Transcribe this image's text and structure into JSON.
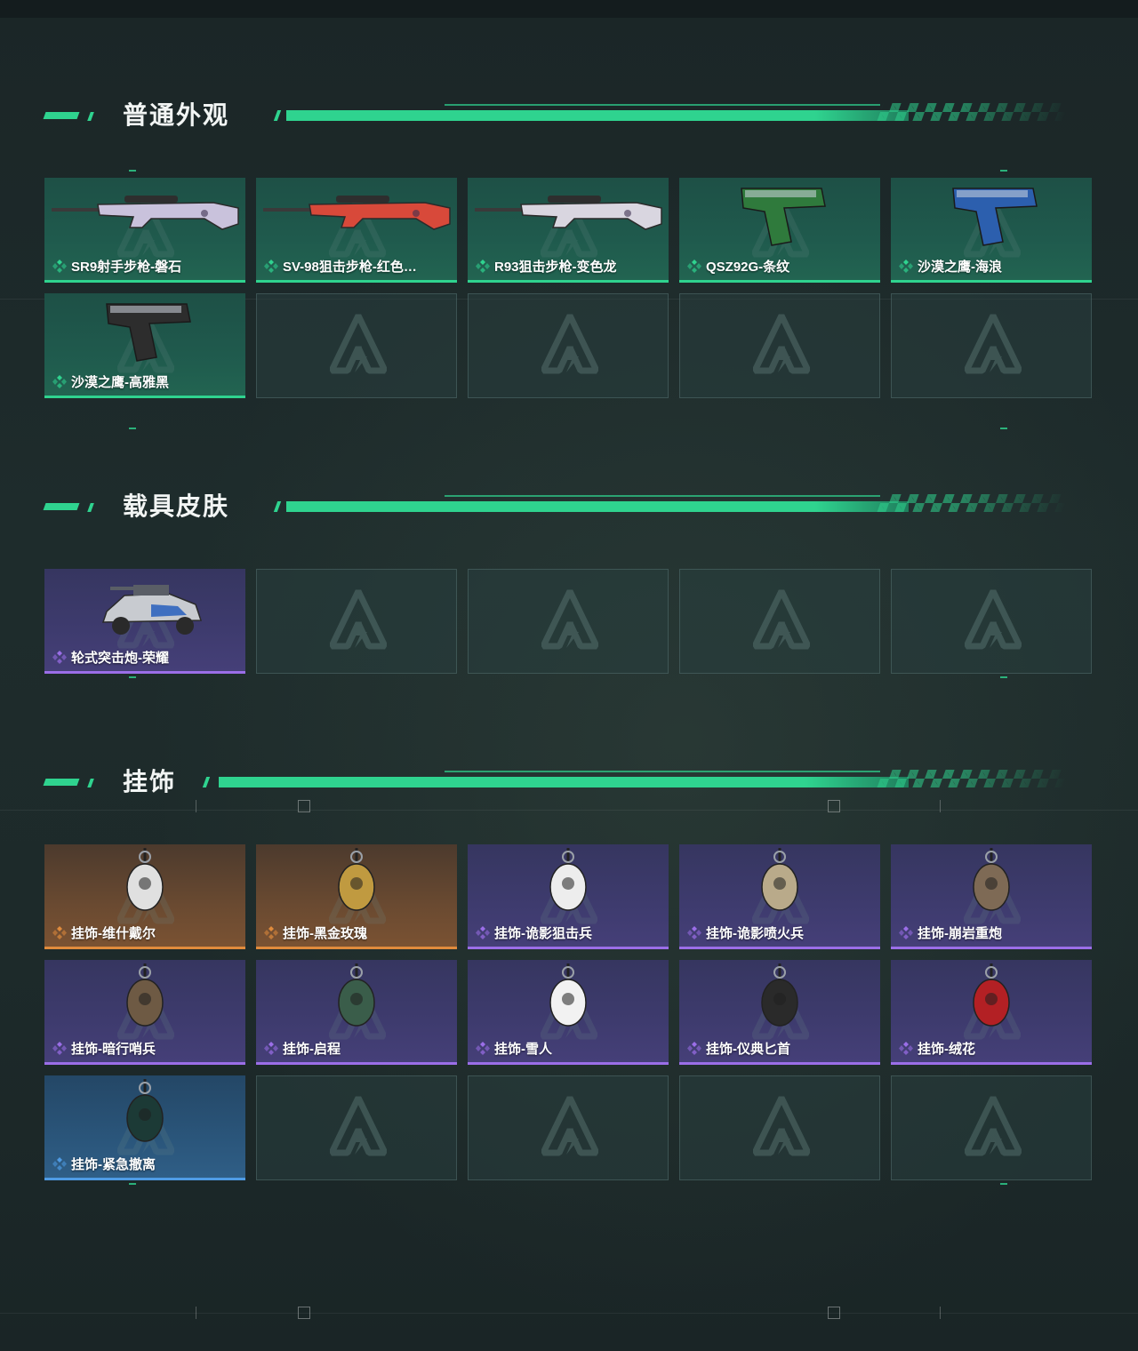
{
  "sections": [
    {
      "title": "普通外观",
      "items": [
        {
          "label": "SR9射手步枪-磐石",
          "rarity": "green",
          "icon": "rifle-image"
        },
        {
          "label": "SV-98狙击步枪-红色…",
          "rarity": "green",
          "icon": "sniper-rifle-image"
        },
        {
          "label": "R93狙击步枪-变色龙",
          "rarity": "green",
          "icon": "sniper-rifle-image"
        },
        {
          "label": "QSZ92G-条纹",
          "rarity": "green",
          "icon": "pistol-image"
        },
        {
          "label": "沙漠之鹰-海浪",
          "rarity": "green",
          "icon": "pistol-image"
        },
        {
          "label": "沙漠之鹰-高雅黑",
          "rarity": "green",
          "icon": "pistol-image"
        }
      ],
      "empty_slots": 4
    },
    {
      "title": "载具皮肤",
      "items": [
        {
          "label": "轮式突击炮-荣耀",
          "rarity": "purple",
          "icon": "vehicle-image"
        }
      ],
      "empty_slots": 4
    },
    {
      "title": "挂饰",
      "items": [
        {
          "label": "挂饰-维什戴尔",
          "rarity": "orange",
          "icon": "charm-image"
        },
        {
          "label": "挂饰-黑金玫瑰",
          "rarity": "orange",
          "icon": "charm-image"
        },
        {
          "label": "挂饰-诡影狙击兵",
          "rarity": "purple",
          "icon": "charm-image"
        },
        {
          "label": "挂饰-诡影喷火兵",
          "rarity": "purple",
          "icon": "charm-image"
        },
        {
          "label": "挂饰-崩岩重炮",
          "rarity": "purple",
          "icon": "charm-image"
        },
        {
          "label": "挂饰-暗行哨兵",
          "rarity": "purple",
          "icon": "charm-image"
        },
        {
          "label": "挂饰-启程",
          "rarity": "purple",
          "icon": "charm-image"
        },
        {
          "label": "挂饰-雪人",
          "rarity": "purple",
          "icon": "charm-image"
        },
        {
          "label": "挂饰-仪典匕首",
          "rarity": "purple",
          "icon": "charm-image"
        },
        {
          "label": "挂饰-绒花",
          "rarity": "purple",
          "icon": "charm-image"
        },
        {
          "label": "挂饰-紧急撤离",
          "rarity": "blue",
          "icon": "charm-image"
        }
      ],
      "empty_slots": 4
    }
  ],
  "rarity_colors": {
    "green": "#2fd38f",
    "purple": "#9b6ee8",
    "orange": "#e08b3c",
    "blue": "#4f9be4"
  },
  "accent_color": "#2fd38f"
}
